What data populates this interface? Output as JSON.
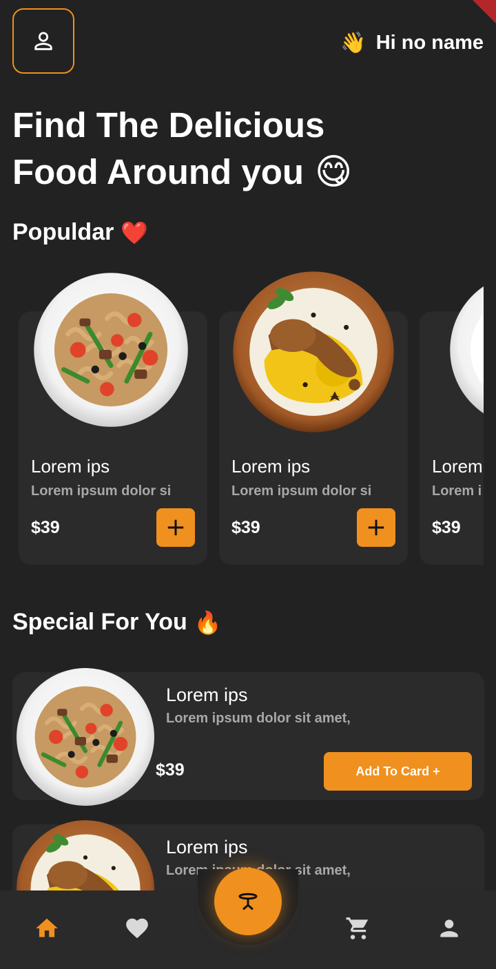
{
  "header": {
    "greeting": "Hi no name",
    "wave_emoji": "👋",
    "avatar_icon": "person-outline-icon"
  },
  "headline": {
    "line1": "Find The Delicious",
    "line2": "Food Around you",
    "emoji": "😋"
  },
  "popular": {
    "title": "Populdar",
    "emoji": "❤️",
    "items": [
      {
        "name": "Lorem ips",
        "desc": "Lorem ipsum dolor si",
        "price": "$39",
        "image": "pasta-plate"
      },
      {
        "name": "Lorem ips",
        "desc": "Lorem ipsum dolor si",
        "price": "$39",
        "image": "biryani-bowl"
      },
      {
        "name": "Lorem",
        "desc": "Lorem i",
        "price": "$39",
        "image": "salad-plate"
      }
    ]
  },
  "special": {
    "title": "Special For You",
    "emoji": "🔥",
    "items": [
      {
        "name": "Lorem ips",
        "desc": "Lorem ipsum dolor sit amet,",
        "price": "$39",
        "button": "Add To Card +",
        "image": "pasta-plate"
      },
      {
        "name": "Lorem ips",
        "desc": "Lorem ipsum dolor sit amet,",
        "price": "",
        "button": "",
        "image": "biryani-bowl"
      }
    ]
  },
  "nav": {
    "items": [
      "home-icon",
      "heart-icon",
      "table-icon",
      "cart-icon",
      "person-icon"
    ],
    "active": "home-icon"
  },
  "colors": {
    "accent": "#f0901e",
    "background": "#222222",
    "card": "#2b2b2b",
    "muted_text": "#a8a8a8",
    "inactive_icon": "#d9d9d9"
  }
}
